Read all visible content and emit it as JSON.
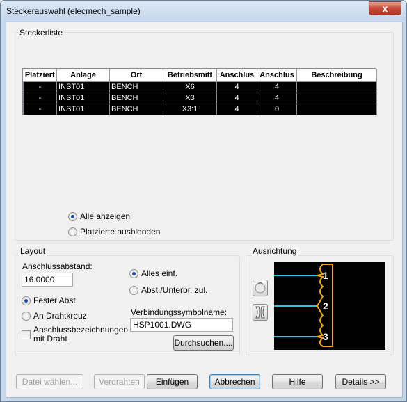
{
  "window": {
    "title": "Steckerauswahl  (elecmech_sample)",
    "close_glyph": "x"
  },
  "steckerliste": {
    "legend": "Steckerliste",
    "columns": [
      "Platziert",
      "Anlage",
      "Ort",
      "Betriebsmitt",
      "Anschlus",
      "Anschlus",
      "Beschreibung"
    ],
    "rows": [
      [
        "-",
        "INST01",
        "BENCH",
        "X6",
        "4",
        "4",
        ""
      ],
      [
        "-",
        "INST01",
        "BENCH",
        "X3",
        "4",
        "4",
        ""
      ],
      [
        "-",
        "INST01",
        "BENCH",
        "X3:1",
        "4",
        "0",
        ""
      ]
    ],
    "show_all_label": "Alle anzeigen",
    "hide_placed_label": "Platzierte ausblenden",
    "selected": "show_all"
  },
  "layout": {
    "legend": "Layout",
    "spacing_label": "Anschlussabstand:",
    "spacing_value": "16.0000",
    "fixed_label": "Fester Abst.",
    "at_wire_label": "An Drahtkreuz.",
    "spacing_mode": "fixed",
    "wire_labels_label_1": "Anschlussbezeichnungen",
    "wire_labels_label_2": "mit Draht",
    "wire_labels_checked": false,
    "insert_all_label": "Alles einf.",
    "gap_label": "Abst./Unterbr. zul.",
    "insert_mode": "all",
    "symbol_label": "Verbindungssymbolname:",
    "symbol_value": "HSP1001.DWG",
    "browse_label": "Durchsuchen...."
  },
  "ausrichtung": {
    "legend": "Ausrichtung",
    "pins": [
      "1",
      "2",
      "3"
    ],
    "wire_color": "#29c6e6",
    "connector_color": "#f2a81d"
  },
  "buttons": {
    "pick_file": "Datei wählen...",
    "wire": "Verdrahten",
    "insert": "Einfügen",
    "cancel": "Abbrechen",
    "help": "Hilfe",
    "details": "Details >>"
  }
}
